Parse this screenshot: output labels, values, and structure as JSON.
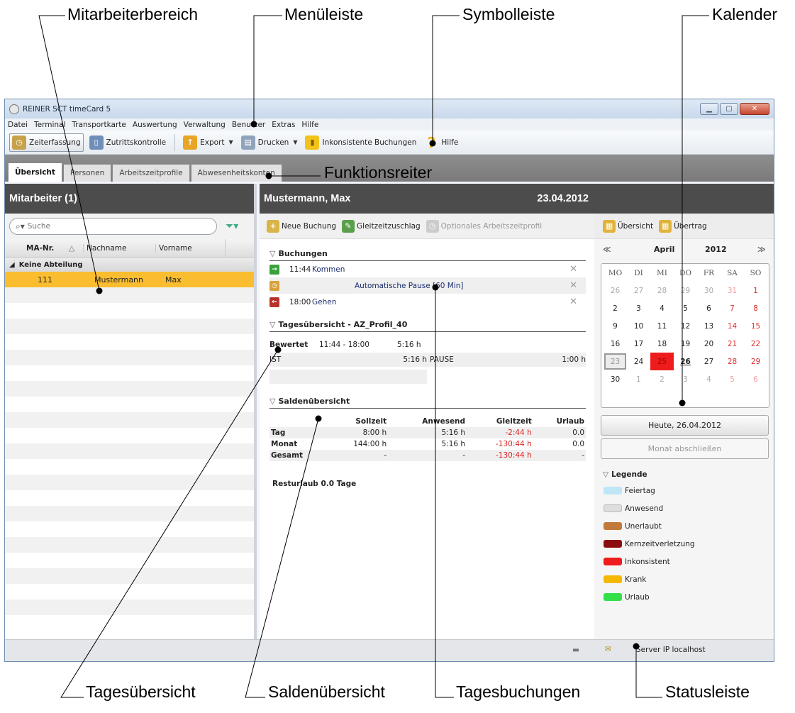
{
  "callouts": {
    "mitarbeiterbereich": "Mitarbeiterbereich",
    "menueleiste": "Menüleiste",
    "symbolleiste": "Symbolleiste",
    "kalender": "Kalender",
    "funktionsreiter": "Funktionsreiter",
    "tagesuebersicht": "Tagesübersicht",
    "saldenuebersicht": "Saldenübersicht",
    "tagesbuchungen": "Tagesbuchungen",
    "statusleiste": "Statusleiste"
  },
  "window": {
    "title": "REINER SCT timeCard 5"
  },
  "menu": [
    "Datei",
    "Terminal",
    "Transportkarte",
    "Auswertung",
    "Verwaltung",
    "Benutzer",
    "Extras",
    "Hilfe"
  ],
  "toolbar": {
    "zeiterfassung": "Zeiterfassung",
    "zutritt": "Zutrittskontrolle",
    "export": "Export",
    "drucken": "Drucken",
    "inkonsistent": "Inkonsistente Buchungen",
    "hilfe": "Hilfe"
  },
  "tabs": [
    "Übersicht",
    "Personen",
    "Arbeitszeitprofile",
    "Abwesenheitskonten"
  ],
  "left": {
    "header": "Mitarbeiter (1)",
    "search_placeholder": "Suche",
    "col_nr": "MA-Nr.",
    "col_nach": "Nachname",
    "col_vor": "Vorname",
    "group": "Keine Abteilung",
    "row": {
      "nr": "111",
      "nach": "Mustermann",
      "vor": "Max"
    }
  },
  "mid": {
    "name": "Mustermann, Max",
    "date": "23.04.2012",
    "neue": "Neue Buchung",
    "gleitzeit": "Gleitzeitzuschlag",
    "optional": "Optionales Arbeitszeitprofil",
    "buchungen_title": "Buchungen",
    "buchungen": [
      {
        "time": "11:44",
        "label": "Kommen",
        "color": "#3aa13a",
        "icon": "→"
      },
      {
        "time": "",
        "label": "Automatische Pause [60 Min]",
        "color": "#d8a23b",
        "icon": "◷"
      },
      {
        "time": "18:00",
        "label": "Gehen",
        "color": "#b8332a",
        "icon": "←"
      }
    ],
    "tages_title": "Tagesübersicht - AZ_Profil_40",
    "bewertet": "Bewertet",
    "bew_range": "11:44 - 18:00",
    "bew_val": "5:16 h",
    "ist": "IST",
    "ist_val": "5:16 h",
    "pause": "PAUSE",
    "pause_val": "1:00 h",
    "salden_title": "Saldenübersicht",
    "salden_head": [
      "",
      "Sollzeit",
      "Anwesend",
      "Gleitzeit",
      "Urlaub"
    ],
    "salden_rows": [
      [
        "Tag",
        "8:00 h",
        "5:16 h",
        "-2:44 h",
        "0.0"
      ],
      [
        "Monat",
        "144:00 h",
        "5:16 h",
        "-130:44 h",
        "0.0"
      ],
      [
        "Gesamt",
        "-",
        "-",
        "-130:44 h",
        "-"
      ]
    ],
    "resturlaub": "Resturlaub 0.0 Tage"
  },
  "right": {
    "uebersicht": "Übersicht",
    "uebertrag": "Übertrag",
    "month": "April",
    "year": "2012",
    "weekdays": [
      "MO",
      "DI",
      "MI",
      "DO",
      "FR",
      "SA",
      "SO"
    ],
    "weeks": [
      [
        "26",
        "27",
        "28",
        "29",
        "30",
        "31",
        "1"
      ],
      [
        "2",
        "3",
        "4",
        "5",
        "6",
        "7",
        "8"
      ],
      [
        "9",
        "10",
        "11",
        "12",
        "13",
        "14",
        "15"
      ],
      [
        "16",
        "17",
        "18",
        "19",
        "20",
        "21",
        "22"
      ],
      [
        "23",
        "24",
        "25",
        "26",
        "27",
        "28",
        "29"
      ],
      [
        "30",
        "1",
        "2",
        "3",
        "4",
        "5",
        "6"
      ]
    ],
    "heute": "Heute, 26.04.2012",
    "monat": "Monat abschließen",
    "legende": "Legende",
    "legend": [
      {
        "label": "Feiertag",
        "color": "#bfe6f7"
      },
      {
        "label": "Anwesend",
        "color": "#dddddd"
      },
      {
        "label": "Unerlaubt",
        "color": "#c17a3a"
      },
      {
        "label": "Kernzeitverletzung",
        "color": "#8b0d0d"
      },
      {
        "label": "Inkonsistent",
        "color": "#ee1c1c"
      },
      {
        "label": "Krank",
        "color": "#f5b800"
      },
      {
        "label": "Urlaub",
        "color": "#33e04a"
      }
    ]
  },
  "status": {
    "server": "Server IP localhost"
  }
}
